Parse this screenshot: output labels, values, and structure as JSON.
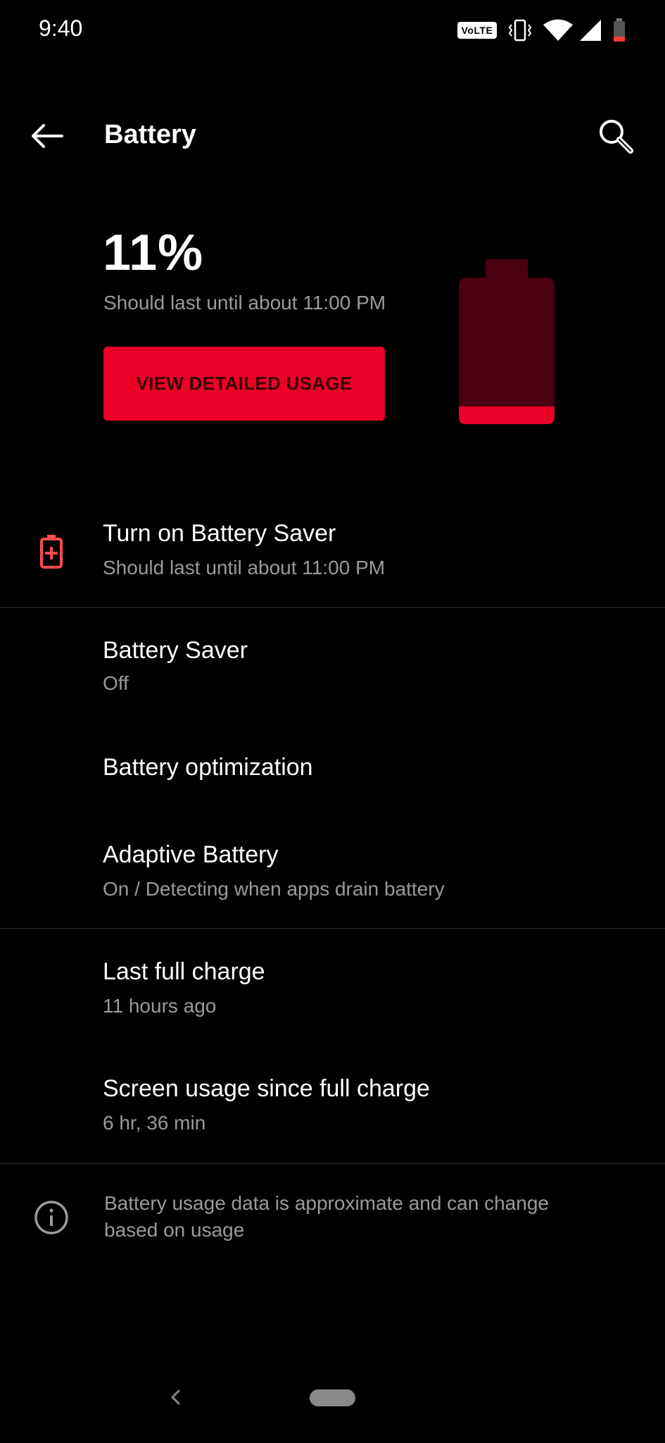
{
  "status_bar": {
    "time": "9:40",
    "volte_label": "VoLTE",
    "icons": [
      "vibrate-icon",
      "wifi-icon",
      "cell-signal-icon",
      "battery-low-icon"
    ]
  },
  "app_bar": {
    "title": "Battery",
    "back_icon": "arrow-left-icon",
    "search_icon": "search-icon"
  },
  "header": {
    "percent": "11%",
    "estimate": "Should last until about 11:00 PM",
    "detail_button": "VIEW DETAILED USAGE",
    "battery_level": 0.11
  },
  "suggestion": {
    "title": "Turn on Battery Saver",
    "subtitle": "Should last until about 11:00 PM",
    "icon": "battery-plus-icon"
  },
  "settings": [
    {
      "title": "Battery Saver",
      "subtitle": "Off"
    },
    {
      "title": "Battery optimization",
      "subtitle": ""
    },
    {
      "title": "Adaptive Battery",
      "subtitle": "On / Detecting when apps drain battery"
    }
  ],
  "usage": [
    {
      "title": "Last full charge",
      "subtitle": "11 hours ago"
    },
    {
      "title": "Screen usage since full charge",
      "subtitle": "6 hr, 36 min"
    }
  ],
  "footer": {
    "info_icon": "info-icon",
    "text_line1": "Battery usage data is approximate and can change",
    "text_line2": "based on usage"
  },
  "colors": {
    "accent": "#eb0028",
    "battery_body": "#4a0010",
    "background": "#000000",
    "secondary_text": "#9a9a9a"
  }
}
